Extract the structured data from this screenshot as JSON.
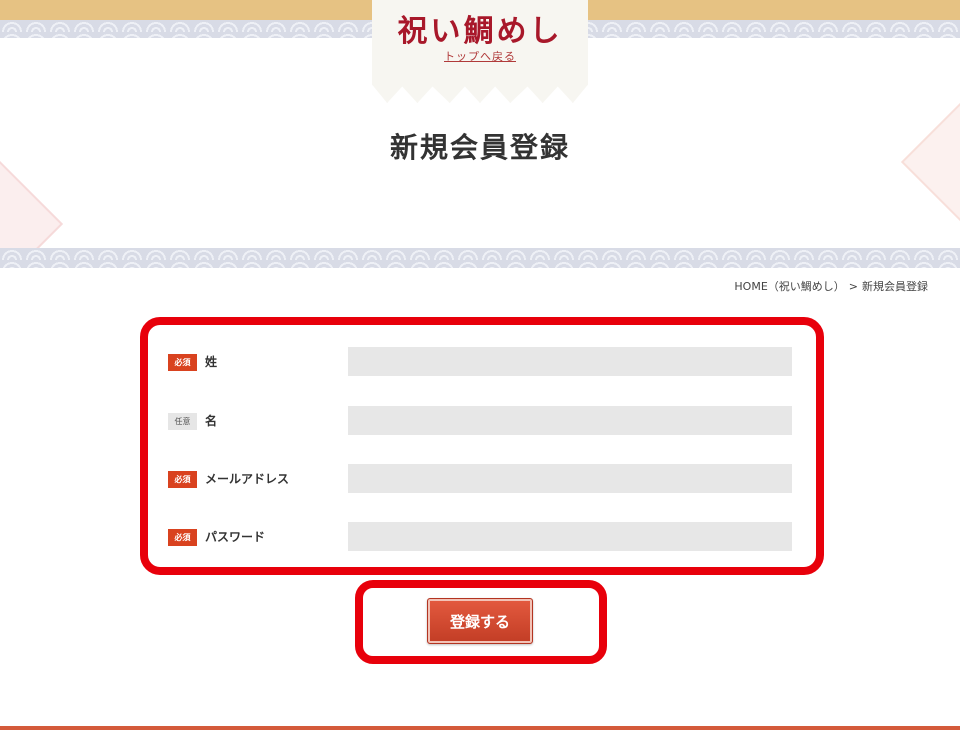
{
  "header": {
    "logo_text": "祝い鯛めし",
    "back_link": "トップへ戻る"
  },
  "page_title": "新規会員登録",
  "breadcrumb": {
    "home": "HOME（祝い鯛めし）",
    "separator": ">",
    "current": "新規会員登録"
  },
  "form": {
    "fields": [
      {
        "badge": "必須",
        "badge_type": "required",
        "label": "姓",
        "value": "",
        "placeholder": ""
      },
      {
        "badge": "任意",
        "badge_type": "optional",
        "label": "名",
        "value": "",
        "placeholder": ""
      },
      {
        "badge": "必須",
        "badge_type": "required",
        "label": "メールアドレス",
        "value": "",
        "placeholder": ""
      },
      {
        "badge": "必須",
        "badge_type": "required",
        "label": "パスワード",
        "value": "",
        "placeholder": ""
      }
    ],
    "submit_label": "登録する"
  },
  "colors": {
    "accent": "#d9421f",
    "highlight_border": "#e8000b",
    "logo": "#a8182a",
    "gold_band": "#e6c283"
  }
}
